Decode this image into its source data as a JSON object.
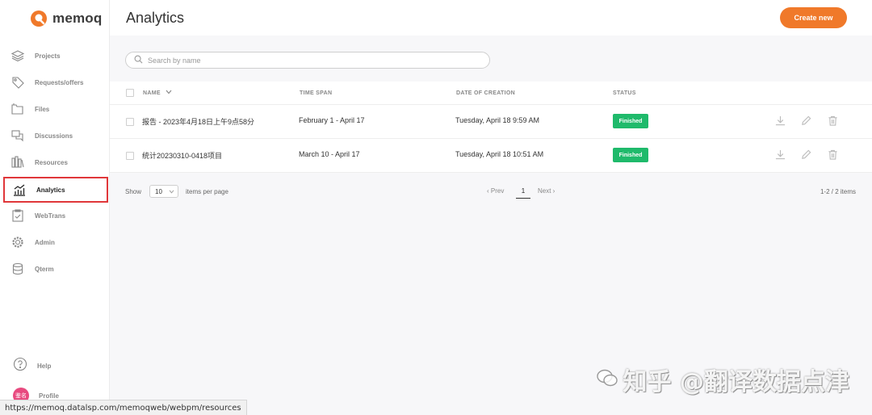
{
  "brand": {
    "name": "memoq",
    "color": "#f0792a"
  },
  "sidebar": {
    "items": [
      {
        "label": "Projects",
        "icon": "layers-icon"
      },
      {
        "label": "Requests/offers",
        "icon": "tag-icon"
      },
      {
        "label": "Files",
        "icon": "folders-icon"
      },
      {
        "label": "Discussions",
        "icon": "chat-icon"
      },
      {
        "label": "Resources",
        "icon": "library-icon"
      },
      {
        "label": "Analytics",
        "icon": "analytics-chart-icon",
        "active": true
      },
      {
        "label": "WebTrans",
        "icon": "clipboard-check-icon"
      },
      {
        "label": "Admin",
        "icon": "gear-icon"
      },
      {
        "label": "Qterm",
        "icon": "database-icon"
      }
    ],
    "help": "Help",
    "profile": "Profile",
    "avatar_text": "鉴名"
  },
  "header": {
    "title": "Analytics",
    "create_button": "Create new"
  },
  "search": {
    "placeholder": "Search by name"
  },
  "table": {
    "columns": [
      "NAME",
      "TIME SPAN",
      "DATE OF CREATION",
      "STATUS"
    ],
    "rows": [
      {
        "name": "报告 - 2023年4月18日上午9点58分",
        "time_span": "February 1 - April 17",
        "created": "Tuesday, April 18 9:59 AM",
        "status": "Finished"
      },
      {
        "name": "统计20230310-0418项目",
        "time_span": "March 10 - April 17",
        "created": "Tuesday, April 18 10:51 AM",
        "status": "Finished"
      }
    ],
    "status_color": "#1fba6b"
  },
  "pager": {
    "show_label": "Show",
    "per_page": "10",
    "items_per_page_label": "items per page",
    "prev": "Prev",
    "current_page": "1",
    "next": "Next",
    "range": "1-2 / 2 items"
  },
  "status_bar": {
    "url": "https://memoq.datalsp.com/memoqweb/webpm/resources"
  },
  "watermark": "知乎 @翻译数据点津"
}
